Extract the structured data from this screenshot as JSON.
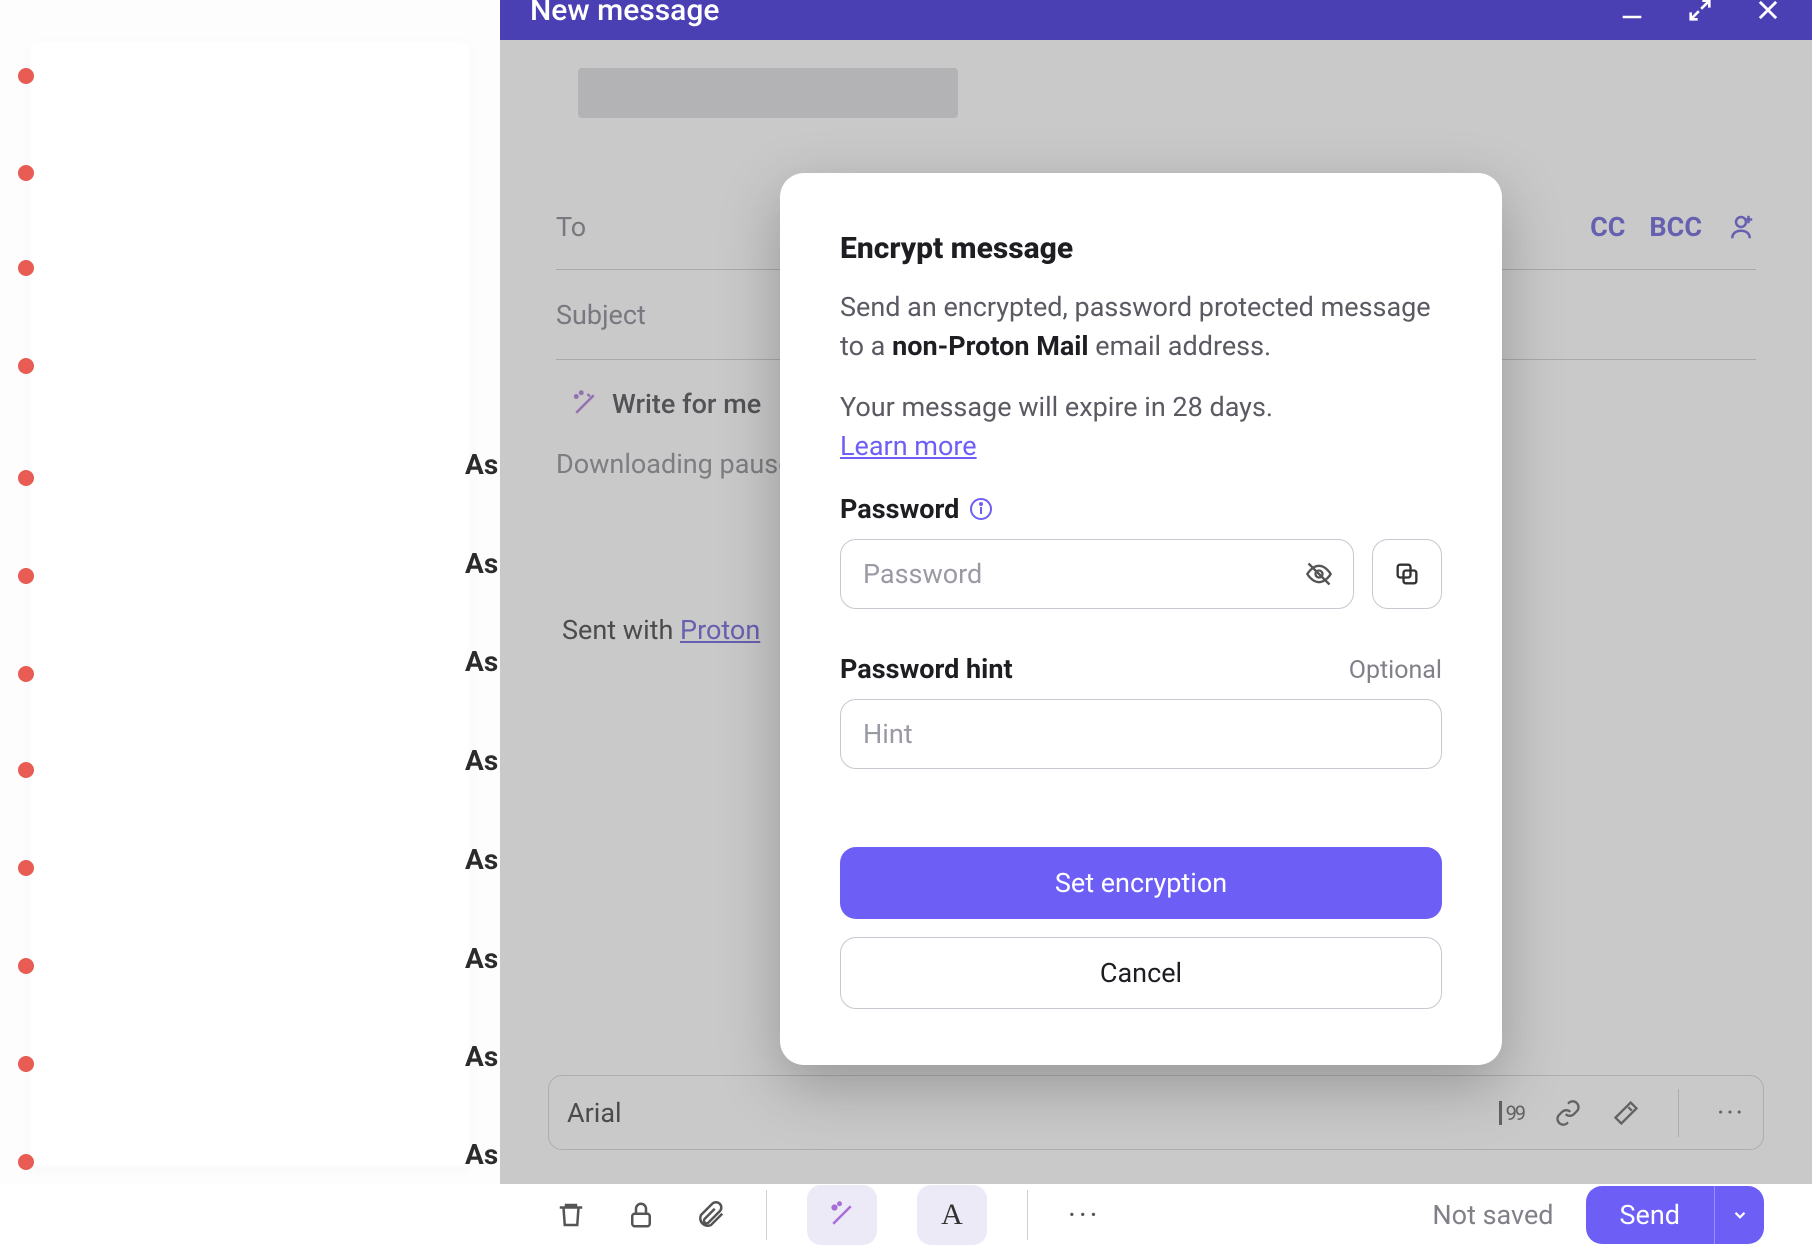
{
  "composer": {
    "title": "New message",
    "to_label": "To",
    "cc_label": "CC",
    "bcc_label": "BCC",
    "subject_placeholder": "Subject",
    "write_for_me_label": "Write for me",
    "download_status": "Downloading paused",
    "sent_with_prefix": "Sent with ",
    "sent_with_link": "Proton"
  },
  "toolbar": {
    "font_name": "Arial",
    "quote_label": "99"
  },
  "actions": {
    "not_saved": "Not saved",
    "send_label": "Send"
  },
  "sidebar": {
    "items": [
      "As",
      "As",
      "As",
      "As",
      "As",
      "As",
      "As",
      "As"
    ]
  },
  "modal": {
    "title": "Encrypt message",
    "desc_pre": "Send an encrypted, password protected message to a ",
    "desc_bold": "non-Proton Mail",
    "desc_post": " email address.",
    "expire_text": "Your message will expire in 28 days.",
    "learn_more": "Learn more",
    "password_label": "Password",
    "password_placeholder": "Password",
    "hint_label": "Password hint",
    "optional_label": "Optional",
    "hint_placeholder": "Hint",
    "set_button": "Set encryption",
    "cancel_button": "Cancel"
  },
  "colors": {
    "accent": "#6d5ff6",
    "titlebar": "#4a3fb3"
  }
}
